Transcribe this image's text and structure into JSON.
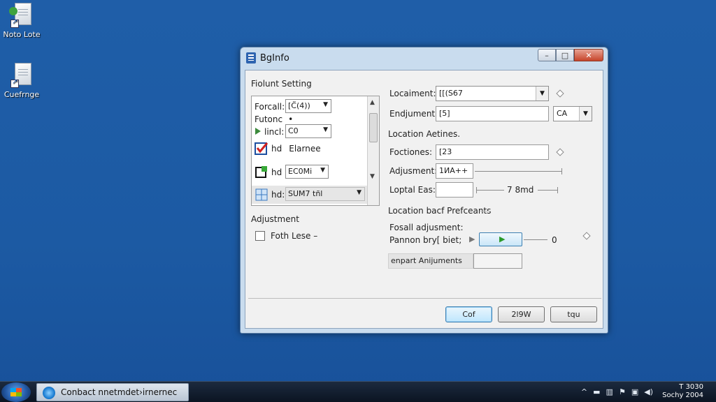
{
  "desktop": {
    "icons": [
      {
        "label": "Noto Lote",
        "icon": "document-icon"
      },
      {
        "label": "Cuefrnge",
        "icon": "document-icon"
      }
    ]
  },
  "window": {
    "title": "BgInfo",
    "close_glyph": "✕",
    "minimize_glyph": "–",
    "maximize_glyph": "□"
  },
  "left_group": {
    "title": "Fiolunt Setting",
    "rows": [
      {
        "label": "Forcall:",
        "value": "[C̈(4))"
      },
      {
        "label": "Futonc",
        "value": "•"
      },
      {
        "label": "lincl:",
        "value": "C0"
      },
      {
        "label": "hd",
        "value": "Elarnee"
      },
      {
        "label": "hd",
        "value": "ЕС0Мі"
      },
      {
        "label": "hd:",
        "value": "SUM7 tñl"
      }
    ],
    "adjustment_title": "Adjustment",
    "checkbox_label": "Foth Lese –"
  },
  "right": {
    "locament_label": "Locaiment:",
    "locament_value": "[[(S67",
    "endjument_label": "Endjument:",
    "endjument_value": "[5]",
    "ca_value": "CA",
    "location_section": "Location Aetines.",
    "foctiones_label": "Foctiones:",
    "foctiones_value": "[23",
    "adjusment_label": "Adjusment:",
    "adjusment_value": "1ИΑ++",
    "loptal_label": "Loptal Eas:",
    "loptal_value": "7 8md",
    "prefs_section": "Location bacf Prefceants",
    "fosall_label": "Fosall adjusment:",
    "pannon_label": "Pannon bry[ biet;",
    "pannon_value": "0",
    "enpart_label": "enpart Anijuments"
  },
  "buttons": {
    "ok": "Cof",
    "mid": "2l9W",
    "cancel": "tqu"
  },
  "taskbar": {
    "item_label": "Conbact nnetmdet›irnernec",
    "clock_time": "T 3030",
    "clock_date": "Sochy 2004"
  }
}
